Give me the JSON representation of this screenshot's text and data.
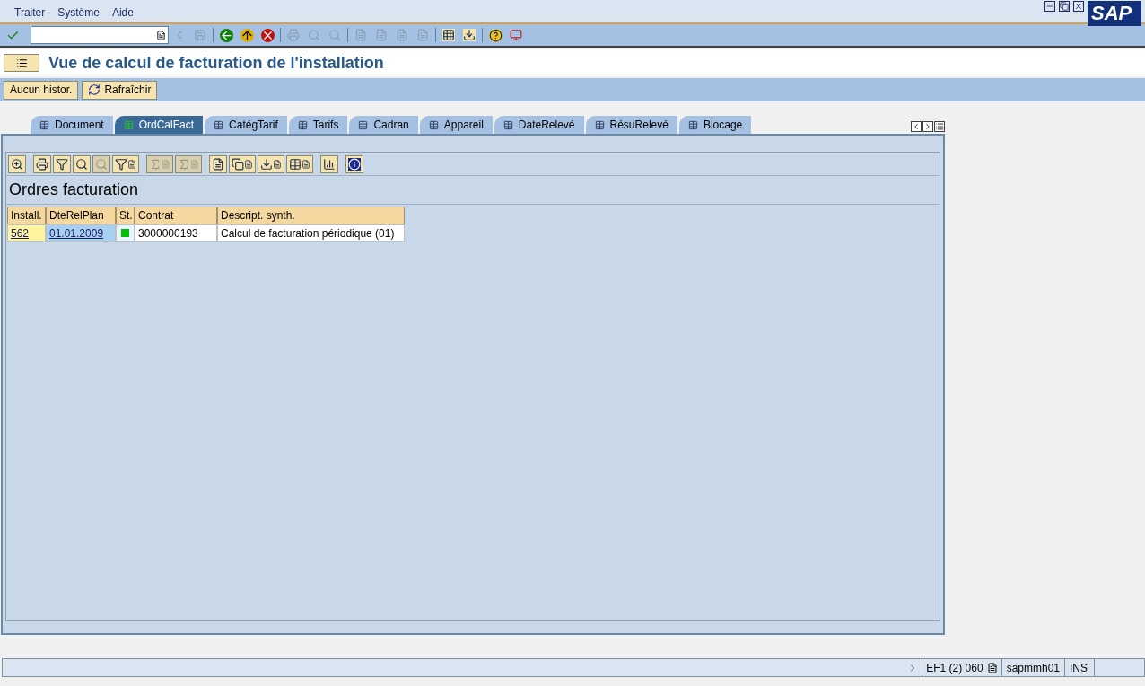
{
  "menu": [
    "Traiter",
    "Système",
    "Aide"
  ],
  "logo": "SAP",
  "title": "Vue de calcul de facturation de l'installation",
  "app_buttons": [
    {
      "label": "Aucun histor.",
      "kind": "text"
    },
    {
      "label": "Rafraîchir",
      "kind": "refresh"
    }
  ],
  "tabs": [
    {
      "label": "Document",
      "selected": false
    },
    {
      "label": "OrdCalFact",
      "selected": true
    },
    {
      "label": "CatégTarif",
      "selected": false
    },
    {
      "label": "Tarifs",
      "selected": false
    },
    {
      "label": "Cadran",
      "selected": false
    },
    {
      "label": "Appareil",
      "selected": false
    },
    {
      "label": "DateRelevé",
      "selected": false
    },
    {
      "label": "RésuRelevé",
      "selected": false
    },
    {
      "label": "Blocage",
      "selected": false
    }
  ],
  "grid": {
    "title": "Ordres facturation",
    "columns": [
      "Install.",
      "DteRelPlan",
      "St.",
      "Contrat",
      "Descript. synth."
    ],
    "rows": [
      {
        "install": "562",
        "date": "01.01.2009",
        "color": "#00c000",
        "contract": "3000000193",
        "description": "Calcul de facturation périodique (01)"
      }
    ]
  },
  "status_bar": {
    "system": "EF1 (2) 060",
    "server": "sapmmh01",
    "mode": "INS"
  }
}
